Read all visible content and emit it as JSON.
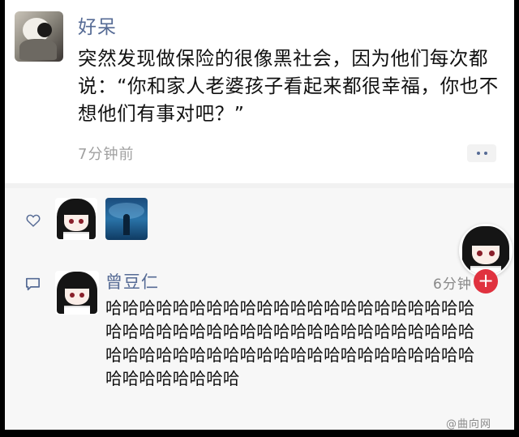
{
  "post": {
    "author": "好呆",
    "content": "突然发现做保险的很像黑社会，因为他们每次都说：“你和家人老婆孩子看起来都很幸福，你也不想他们有事对吧？”",
    "time": "7分钟前",
    "avatar_icon": "user-photo-avatar",
    "more_icon": "more-dots-icon"
  },
  "likes": {
    "icon": "heart-icon",
    "avatars": [
      "anime-girl-avatar",
      "blue-underwater-avatar"
    ]
  },
  "comment": {
    "icon": "comment-icon",
    "author": "曾豆仁",
    "time": "6分钟",
    "text": "哈哈哈哈哈哈哈哈哈哈哈哈哈哈哈哈哈哈哈哈哈哈哈哈哈哈哈哈哈哈哈哈哈哈哈哈哈哈哈哈哈哈哈哈哈哈哈哈哈哈哈哈哈哈哈哈哈哈哈哈哈哈哈哈哈哈哈哈哈哈哈哈哈哈"
  },
  "floating": {
    "plus_label": "+"
  },
  "watermark": "@曲向网",
  "colors": {
    "name_blue": "#566b95",
    "badge_red": "#e0323f",
    "panel_gray": "#f7f7f7"
  }
}
